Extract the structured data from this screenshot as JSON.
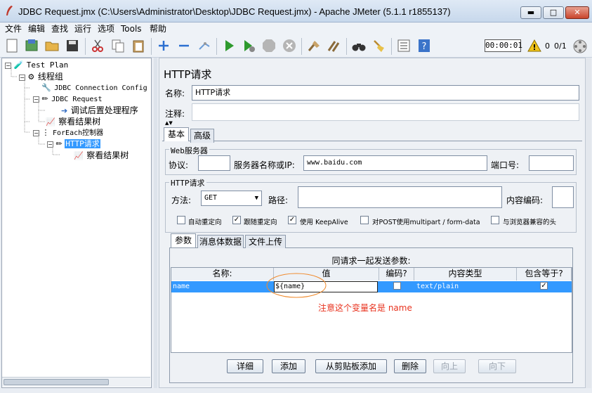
{
  "window": {
    "title": "JDBC Request.jmx (C:\\Users\\Administrator\\Desktop\\JDBC Request.jmx) - Apache JMeter (5.1.1 r1855137)",
    "min_label": "▬",
    "max_label": "□",
    "close_label": "✕"
  },
  "menu": [
    "文件",
    "编辑",
    "查找",
    "运行",
    "选项",
    "Tools",
    "帮助"
  ],
  "toolbar": {
    "timer": "00:00:01",
    "warnings": "0",
    "threads": "0/1"
  },
  "tree": {
    "nodes": [
      {
        "label": "Test Plan",
        "icon": "test-plan-icon"
      },
      {
        "label": "线程组",
        "icon": "thread-group-icon"
      },
      {
        "label": "JDBC Connection Config",
        "icon": "wrench-icon"
      },
      {
        "label": "JDBC Request",
        "icon": "sampler-icon"
      },
      {
        "label": "调试后置处理程序",
        "icon": "post-processor-icon"
      },
      {
        "label": "察看结果树",
        "icon": "listener-icon"
      },
      {
        "label": "ForEach控制器",
        "icon": "controller-icon"
      },
      {
        "label": "HTTP请求",
        "icon": "pencil-icon"
      },
      {
        "label": "察看结果树",
        "icon": "listener-icon"
      }
    ]
  },
  "panel": {
    "heading": "HTTP请求",
    "name_label": "名称:",
    "name_value": "HTTP请求",
    "comment_label": "注释:",
    "comment_value": "",
    "tabs": [
      "基本",
      "高级"
    ],
    "web_server": {
      "title": "Web服务器",
      "protocol_label": "协议:",
      "protocol_value": "",
      "server_label": "服务器名称或IP:",
      "server_value": "www.baidu.com",
      "port_label": "端口号:",
      "port_value": ""
    },
    "http_request": {
      "title": "HTTP请求",
      "method_label": "方法:",
      "method_value": "GET",
      "path_label": "路径:",
      "path_value": "",
      "encoding_label": "内容编码:",
      "encoding_value": ""
    },
    "checkboxes": [
      {
        "label": "自动重定向",
        "checked": false
      },
      {
        "label": "跟随重定向",
        "checked": true
      },
      {
        "label": "使用 KeepAlive",
        "checked": true
      },
      {
        "label": "对POST使用multipart / form-data",
        "checked": false
      },
      {
        "label": "与浏览器兼容的头",
        "checked": false
      }
    ],
    "subtabs": [
      "参数",
      "消息体数据",
      "文件上传"
    ],
    "params_caption": "同请求一起发送参数:",
    "columns": [
      "名称:",
      "值",
      "编码?",
      "内容类型",
      "包含等于?"
    ],
    "row": {
      "name": "name",
      "value": "${name}",
      "encode": false,
      "content_type": "text/plain",
      "include_equals": true
    },
    "annotation": "注意这个变量名是 name",
    "buttons": [
      "详细",
      "添加",
      "从剪贴板添加",
      "删除",
      "向上",
      "向下"
    ]
  },
  "colors": {
    "selection": "#3399ff",
    "annotation": "#e8321e"
  }
}
